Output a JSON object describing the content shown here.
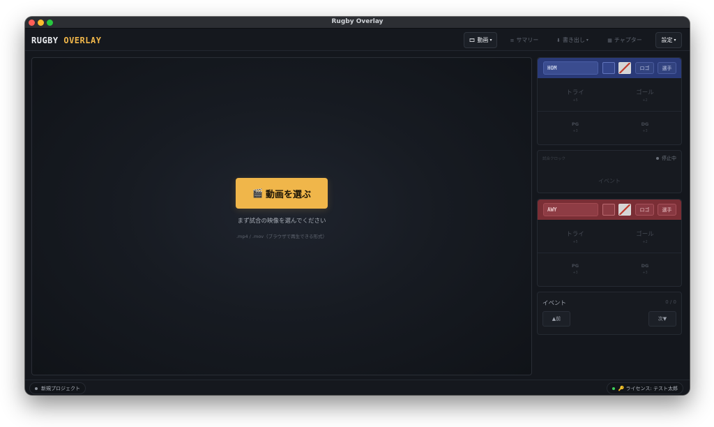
{
  "window": {
    "title": "Rugby Overlay"
  },
  "app": {
    "logo_primary": "RUGBY",
    "logo_accent": "OVERLAY"
  },
  "toolbar": {
    "video_label": "動画",
    "summary_label": "サマリー",
    "export_label": "書き出し",
    "chapter_label": "チャプター",
    "settings_label": "設定"
  },
  "video": {
    "choose_label": "動画を選ぶ",
    "hint": "まず試合の映像を選んでください",
    "formats": ".mp4 / .mov（ブラウザで再生できる形式）"
  },
  "home": {
    "name": "HOM",
    "logo_btn": "ロゴ",
    "player_btn": "選手",
    "try_label": "トライ",
    "try_sub": "+5",
    "goal_label": "ゴール",
    "goal_sub": "+2",
    "pg_label": "PG",
    "pg_sub": "+3",
    "dg_label": "DG",
    "dg_sub": "+3"
  },
  "clock": {
    "title": "試合クロック",
    "status": "停止中",
    "event_placeholder": "イベント"
  },
  "away": {
    "name": "AWY",
    "logo_btn": "ロゴ",
    "player_btn": "選手",
    "try_label": "トライ",
    "try_sub": "+5",
    "goal_label": "ゴール",
    "goal_sub": "+2",
    "pg_label": "PG",
    "pg_sub": "+3",
    "dg_label": "DG",
    "dg_sub": "+3"
  },
  "events": {
    "title": "イベント",
    "count": "0 / 0",
    "prev_label": "▲前",
    "next_label": "次▼"
  },
  "status": {
    "project": "新規プロジェクト",
    "license": "ライセンス: テスト太郎"
  },
  "colors": {
    "accent": "#f0b64a",
    "home": "#2a3a78",
    "away": "#7a2e35",
    "online": "#3ecf5b"
  }
}
